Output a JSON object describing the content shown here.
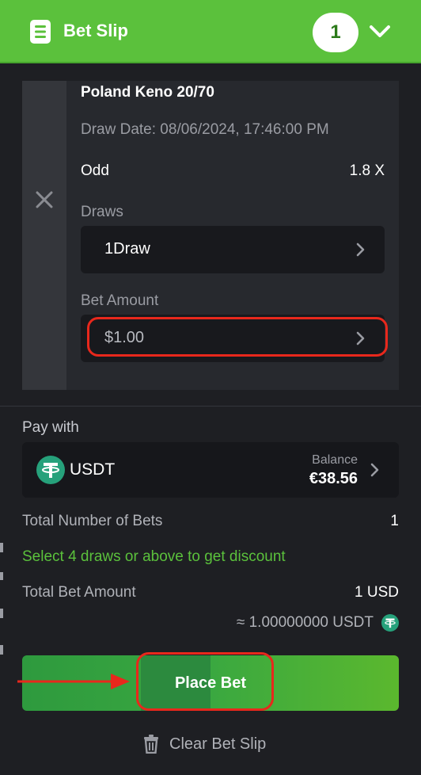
{
  "header": {
    "title": "Bet Slip",
    "count": "1",
    "color_accent": "#5bc13c"
  },
  "bet": {
    "game": "Poland Keno 20/70",
    "draw_date": "Draw Date: 08/06/2024, 17:46:00 PM",
    "odd_label": "Odd",
    "odd_value": "1.8 X",
    "draws_label": "Draws",
    "draws_value": "1Draw",
    "amount_label": "Bet Amount",
    "amount_value": "$1.00"
  },
  "payment": {
    "label": "Pay with",
    "currency": "USDT",
    "balance_label": "Balance",
    "balance_value": "€38.56",
    "coin_color": "#26a17b"
  },
  "summary": {
    "total_bets_label": "Total Number of Bets",
    "total_bets_value": "1",
    "discount_message": "Select 4 draws or above to get discount",
    "total_amount_label": "Total Bet Amount",
    "total_amount_value": "1 USD",
    "approx_value": "≈ 1.00000000 USDT"
  },
  "actions": {
    "place_bet": "Place Bet",
    "clear_slip": "Clear Bet Slip"
  },
  "annotations": {
    "highlight_color": "#e8281c"
  }
}
